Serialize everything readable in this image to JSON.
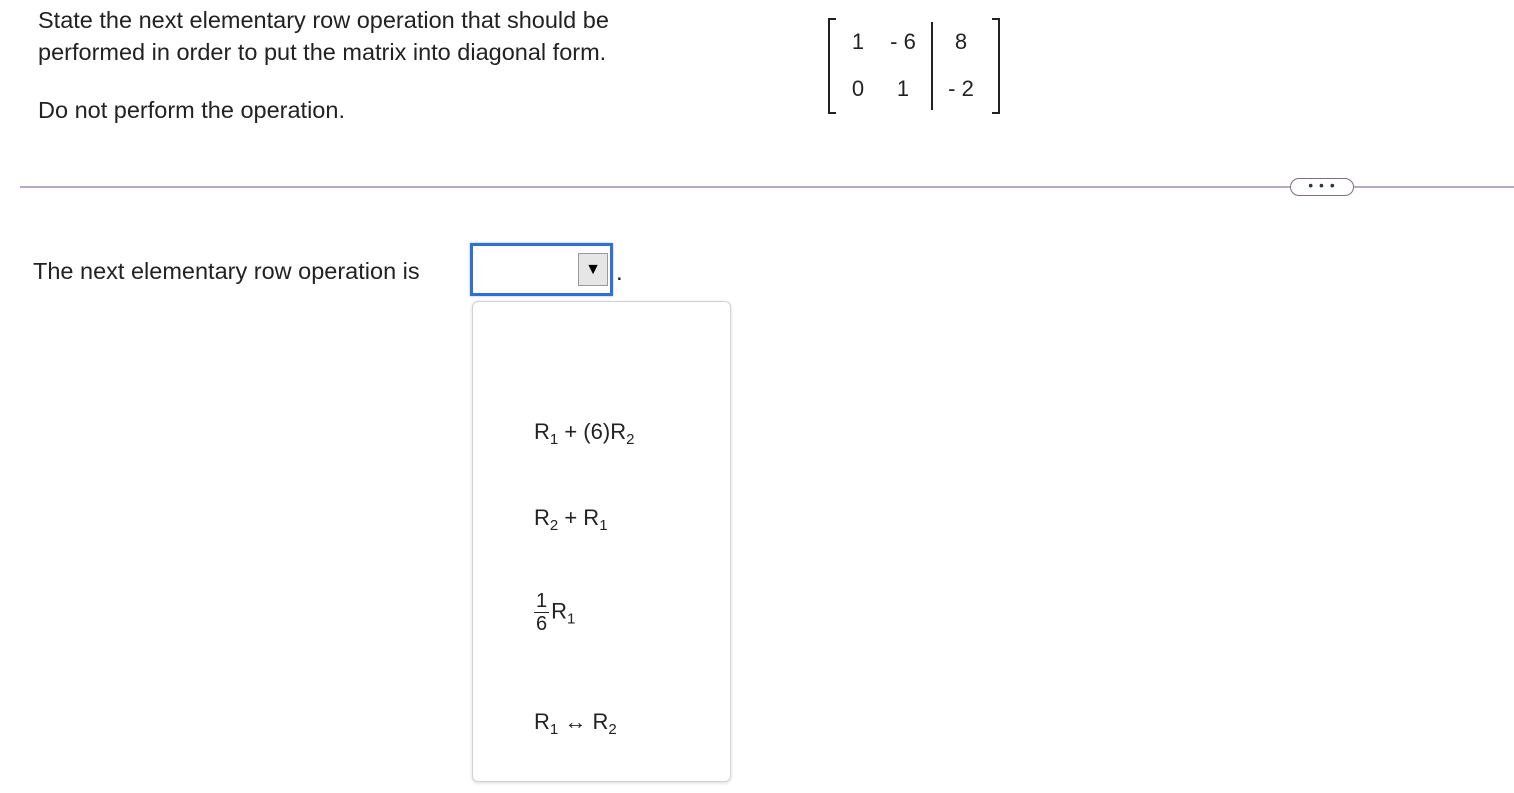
{
  "instructions": {
    "line1": "State the next elementary row operation that should be",
    "line2": "performed in order to put the matrix into diagonal form.",
    "line3": "Do not perform the operation."
  },
  "matrix": {
    "r1c1": "1",
    "r1c2": "- 6",
    "r1c3": "8",
    "r2c1": "0",
    "r2c2": "1",
    "r2c3": "- 2"
  },
  "more_button": "• • •",
  "question": {
    "label": "The next elementary row operation is",
    "selected_value": "",
    "trailing_period": "."
  },
  "dropdown": {
    "options": [
      {
        "a": "R",
        "a_sub": "1",
        "op": " + (6)R",
        "b_sub": "2"
      },
      {
        "a": "R",
        "a_sub": "2",
        "op": " + R",
        "b_sub": "1"
      },
      {
        "num": "1",
        "den": "6",
        "a": "R",
        "a_sub": "1"
      },
      {
        "a": "R",
        "a_sub": "1",
        "op": " ↔ R",
        "b_sub": "2"
      }
    ]
  }
}
